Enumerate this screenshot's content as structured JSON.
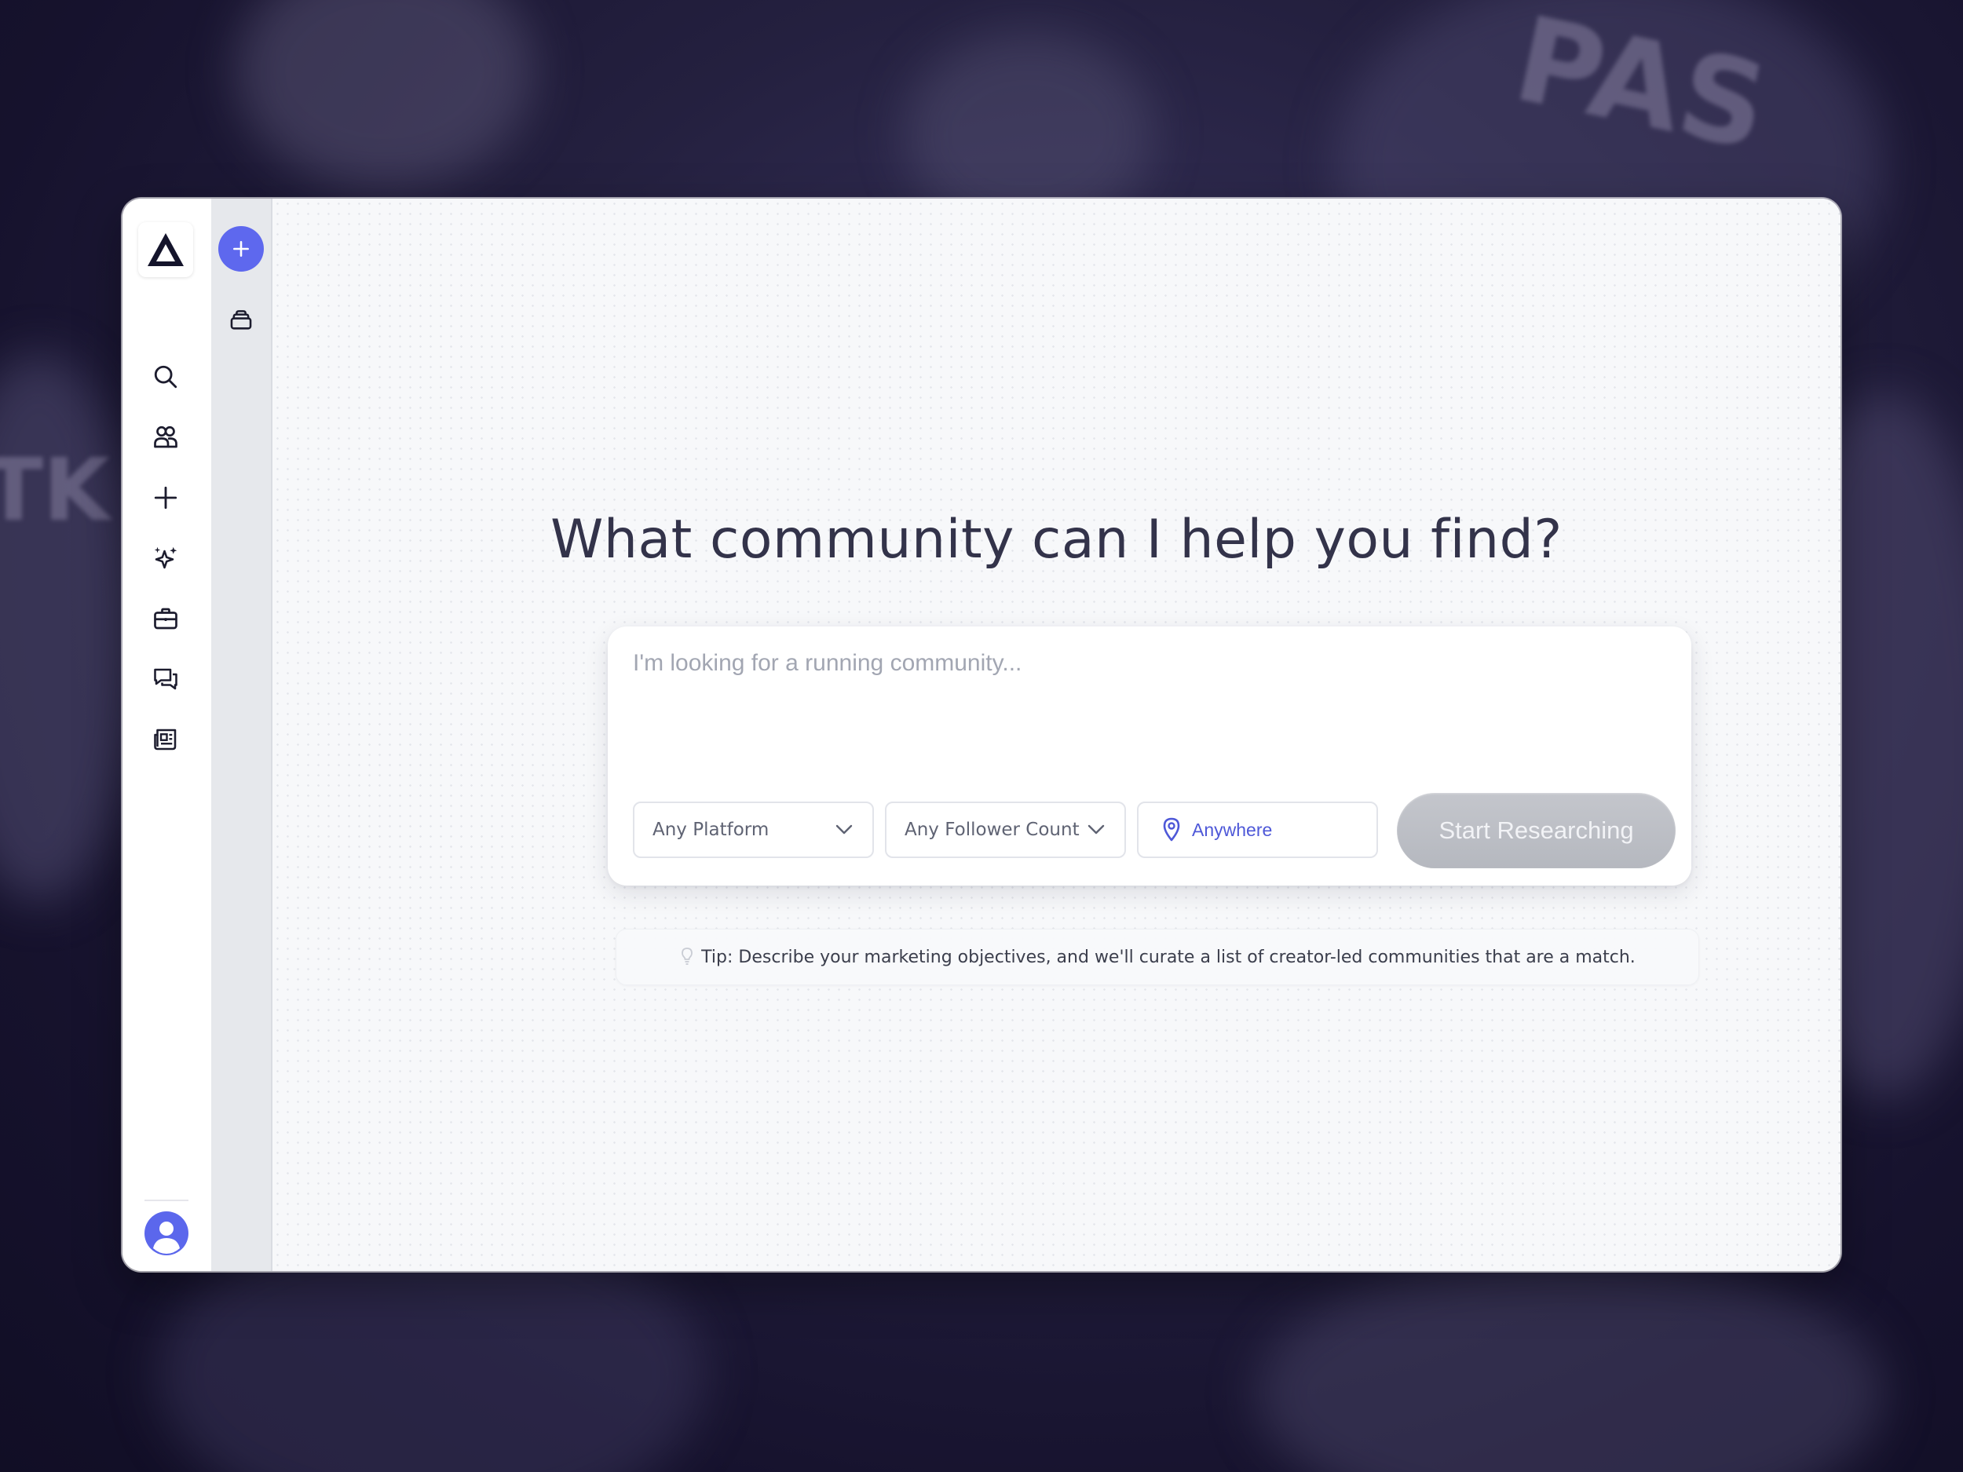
{
  "app": {
    "logo_icon": "delta-triangle-logo"
  },
  "sidebar": {
    "items": [
      {
        "name": "search",
        "icon": "search-icon"
      },
      {
        "name": "communities",
        "icon": "users-icon"
      },
      {
        "name": "create",
        "icon": "plus-icon"
      },
      {
        "name": "ai-discover",
        "icon": "sparkles-icon"
      },
      {
        "name": "campaigns",
        "icon": "briefcase-icon"
      },
      {
        "name": "messages",
        "icon": "chat-icon"
      },
      {
        "name": "news",
        "icon": "newspaper-icon"
      }
    ],
    "avatar_icon": "user-avatar"
  },
  "subpanel": {
    "new_button_icon": "plus-icon",
    "stack_icon": "stack-icon"
  },
  "main": {
    "headline": "What community can I help you find?",
    "search": {
      "placeholder": "I'm looking for a running community...",
      "value": ""
    },
    "filters": {
      "platform": "Any Platform",
      "follower_count": "Any Follower Count",
      "location": "Anywhere"
    },
    "start_button": "Start Researching",
    "tip": "Tip: Describe your marketing objectives, and we'll curate a list of creator-led communities that are a match."
  },
  "colors": {
    "accent": "#5e68ee",
    "text_dark": "#33334a",
    "button_disabled": "#bfc1c7",
    "background": "#1b1736"
  }
}
